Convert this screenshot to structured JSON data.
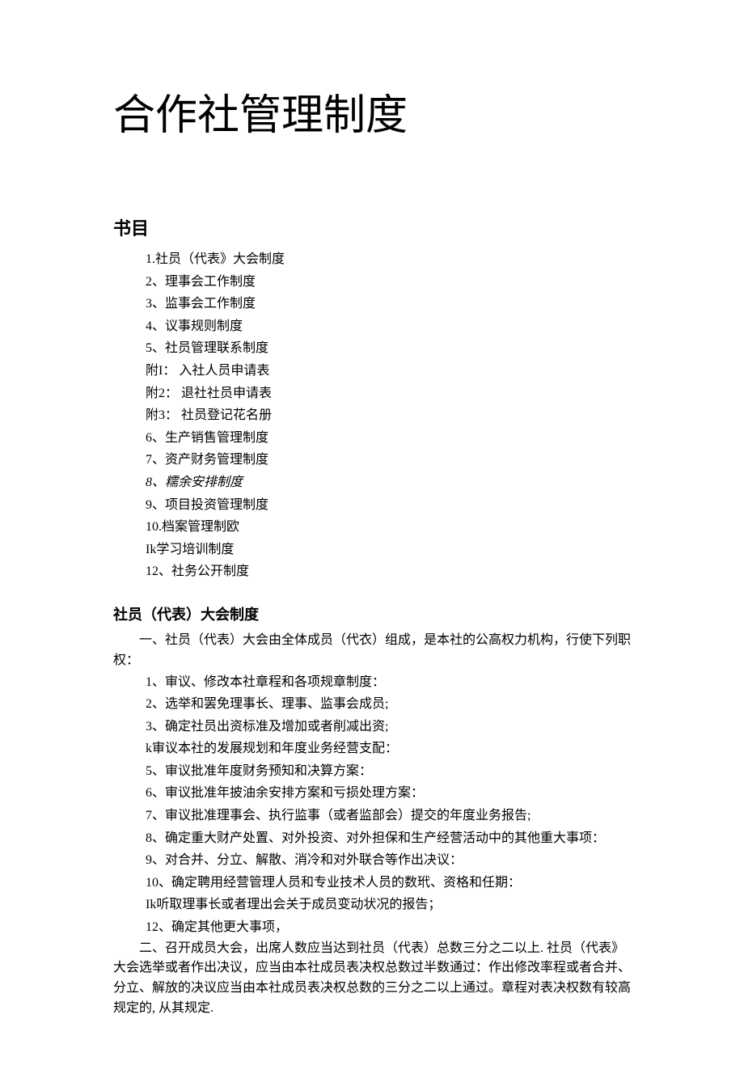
{
  "title": "合作社管理制度",
  "toc_header": "书目",
  "toc": [
    "1.社员（代表》大会制度",
    "2、理事会工作制度",
    "3、监事会工作制度",
    "4、议事规则制度",
    "5、社员管理联系制度",
    "附I： 入社人员申请表",
    "附2： 退社社员申请表",
    "附3： 社员登记花名册",
    "6、生产销售管理制度",
    "7、资产财务管理制度",
    "8、糯余安排制度",
    "9、项目投资管理制度",
    "10.档案管理制欧",
    "Ik学习培训制度",
    "12、社务公开制度"
  ],
  "section1": {
    "title": "社员（代表）大会制度",
    "intro_line1": "一、社员（代表）大会由全体成员（代衣）组成，是本社的公高权力机构，行使下列职",
    "intro_line2": "权：",
    "items": [
      "1、审议、修改本社章程和各项规章制度：",
      "2、选举和罢免理事长、理事、监事会成员;",
      "3、确定社员出资标准及增加或者削减出资;",
      "k审议本社的发展规划和年度业务经营支配：",
      "5、审议批准年度财务预知和决算方案：",
      "6、审议批准年披油余安排方案和亏损处理方案：",
      "7、审议批准理事会、执行监事（或者监部会）提交的年度业务报告;",
      "8、确定重大财产处置、对外投资、对外担保和生产经营活动中的其他重大事项：",
      "9、对合并、分立、解散、消冷和对外联合等作出决议：",
      "10、确定聘用经营管理人员和专业技术人员的数玳、资格和任期：",
      "Ik听取理事长或者理出会关于成员变动状况的报告；",
      "12、确定其他更大事项，"
    ],
    "para2": "二、召开成员大会，出席人数应当达到社员（代表）总数三分之二以上. 社员（代表》大会选举或者作出决议，应当由本社成员表决权总数过半数通过：作出修改率程或者合并、分立、解放的决议应当由本社成员表决权总数的三分之二以上通过。章程对表决权数有较高规定的, 从其规定."
  }
}
